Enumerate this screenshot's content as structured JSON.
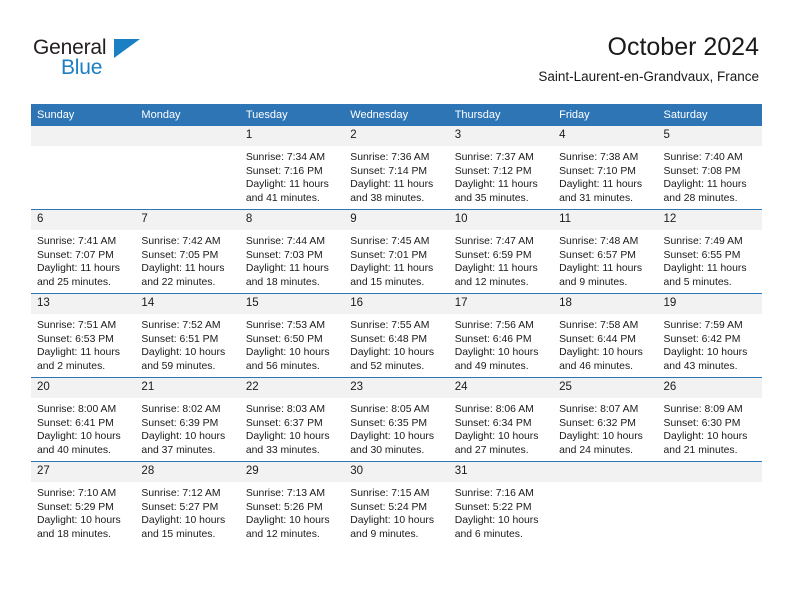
{
  "brand": {
    "name_part1": "General",
    "name_part2": "Blue",
    "accent_color": "#1b7fc4"
  },
  "header": {
    "title": "October 2024",
    "subtitle": "Saint-Laurent-en-Grandvaux, France",
    "header_bg_color": "#2e75b6",
    "daynum_bg_color": "#f2f2f2"
  },
  "weekdays": [
    "Sunday",
    "Monday",
    "Tuesday",
    "Wednesday",
    "Thursday",
    "Friday",
    "Saturday"
  ],
  "labels": {
    "sunrise_prefix": "Sunrise:",
    "sunset_prefix": "Sunset:",
    "daylight_prefix": "Daylight:"
  },
  "weeks": [
    [
      {
        "day": "",
        "empty": true
      },
      {
        "day": "",
        "empty": true
      },
      {
        "day": "1",
        "sunrise": "Sunrise: 7:34 AM",
        "sunset": "Sunset: 7:16 PM",
        "daylight_line1": "Daylight: 11 hours",
        "daylight_line2": "and 41 minutes."
      },
      {
        "day": "2",
        "sunrise": "Sunrise: 7:36 AM",
        "sunset": "Sunset: 7:14 PM",
        "daylight_line1": "Daylight: 11 hours",
        "daylight_line2": "and 38 minutes."
      },
      {
        "day": "3",
        "sunrise": "Sunrise: 7:37 AM",
        "sunset": "Sunset: 7:12 PM",
        "daylight_line1": "Daylight: 11 hours",
        "daylight_line2": "and 35 minutes."
      },
      {
        "day": "4",
        "sunrise": "Sunrise: 7:38 AM",
        "sunset": "Sunset: 7:10 PM",
        "daylight_line1": "Daylight: 11 hours",
        "daylight_line2": "and 31 minutes."
      },
      {
        "day": "5",
        "sunrise": "Sunrise: 7:40 AM",
        "sunset": "Sunset: 7:08 PM",
        "daylight_line1": "Daylight: 11 hours",
        "daylight_line2": "and 28 minutes."
      }
    ],
    [
      {
        "day": "6",
        "sunrise": "Sunrise: 7:41 AM",
        "sunset": "Sunset: 7:07 PM",
        "daylight_line1": "Daylight: 11 hours",
        "daylight_line2": "and 25 minutes."
      },
      {
        "day": "7",
        "sunrise": "Sunrise: 7:42 AM",
        "sunset": "Sunset: 7:05 PM",
        "daylight_line1": "Daylight: 11 hours",
        "daylight_line2": "and 22 minutes."
      },
      {
        "day": "8",
        "sunrise": "Sunrise: 7:44 AM",
        "sunset": "Sunset: 7:03 PM",
        "daylight_line1": "Daylight: 11 hours",
        "daylight_line2": "and 18 minutes."
      },
      {
        "day": "9",
        "sunrise": "Sunrise: 7:45 AM",
        "sunset": "Sunset: 7:01 PM",
        "daylight_line1": "Daylight: 11 hours",
        "daylight_line2": "and 15 minutes."
      },
      {
        "day": "10",
        "sunrise": "Sunrise: 7:47 AM",
        "sunset": "Sunset: 6:59 PM",
        "daylight_line1": "Daylight: 11 hours",
        "daylight_line2": "and 12 minutes."
      },
      {
        "day": "11",
        "sunrise": "Sunrise: 7:48 AM",
        "sunset": "Sunset: 6:57 PM",
        "daylight_line1": "Daylight: 11 hours",
        "daylight_line2": "and 9 minutes."
      },
      {
        "day": "12",
        "sunrise": "Sunrise: 7:49 AM",
        "sunset": "Sunset: 6:55 PM",
        "daylight_line1": "Daylight: 11 hours",
        "daylight_line2": "and 5 minutes."
      }
    ],
    [
      {
        "day": "13",
        "sunrise": "Sunrise: 7:51 AM",
        "sunset": "Sunset: 6:53 PM",
        "daylight_line1": "Daylight: 11 hours",
        "daylight_line2": "and 2 minutes."
      },
      {
        "day": "14",
        "sunrise": "Sunrise: 7:52 AM",
        "sunset": "Sunset: 6:51 PM",
        "daylight_line1": "Daylight: 10 hours",
        "daylight_line2": "and 59 minutes."
      },
      {
        "day": "15",
        "sunrise": "Sunrise: 7:53 AM",
        "sunset": "Sunset: 6:50 PM",
        "daylight_line1": "Daylight: 10 hours",
        "daylight_line2": "and 56 minutes."
      },
      {
        "day": "16",
        "sunrise": "Sunrise: 7:55 AM",
        "sunset": "Sunset: 6:48 PM",
        "daylight_line1": "Daylight: 10 hours",
        "daylight_line2": "and 52 minutes."
      },
      {
        "day": "17",
        "sunrise": "Sunrise: 7:56 AM",
        "sunset": "Sunset: 6:46 PM",
        "daylight_line1": "Daylight: 10 hours",
        "daylight_line2": "and 49 minutes."
      },
      {
        "day": "18",
        "sunrise": "Sunrise: 7:58 AM",
        "sunset": "Sunset: 6:44 PM",
        "daylight_line1": "Daylight: 10 hours",
        "daylight_line2": "and 46 minutes."
      },
      {
        "day": "19",
        "sunrise": "Sunrise: 7:59 AM",
        "sunset": "Sunset: 6:42 PM",
        "daylight_line1": "Daylight: 10 hours",
        "daylight_line2": "and 43 minutes."
      }
    ],
    [
      {
        "day": "20",
        "sunrise": "Sunrise: 8:00 AM",
        "sunset": "Sunset: 6:41 PM",
        "daylight_line1": "Daylight: 10 hours",
        "daylight_line2": "and 40 minutes."
      },
      {
        "day": "21",
        "sunrise": "Sunrise: 8:02 AM",
        "sunset": "Sunset: 6:39 PM",
        "daylight_line1": "Daylight: 10 hours",
        "daylight_line2": "and 37 minutes."
      },
      {
        "day": "22",
        "sunrise": "Sunrise: 8:03 AM",
        "sunset": "Sunset: 6:37 PM",
        "daylight_line1": "Daylight: 10 hours",
        "daylight_line2": "and 33 minutes."
      },
      {
        "day": "23",
        "sunrise": "Sunrise: 8:05 AM",
        "sunset": "Sunset: 6:35 PM",
        "daylight_line1": "Daylight: 10 hours",
        "daylight_line2": "and 30 minutes."
      },
      {
        "day": "24",
        "sunrise": "Sunrise: 8:06 AM",
        "sunset": "Sunset: 6:34 PM",
        "daylight_line1": "Daylight: 10 hours",
        "daylight_line2": "and 27 minutes."
      },
      {
        "day": "25",
        "sunrise": "Sunrise: 8:07 AM",
        "sunset": "Sunset: 6:32 PM",
        "daylight_line1": "Daylight: 10 hours",
        "daylight_line2": "and 24 minutes."
      },
      {
        "day": "26",
        "sunrise": "Sunrise: 8:09 AM",
        "sunset": "Sunset: 6:30 PM",
        "daylight_line1": "Daylight: 10 hours",
        "daylight_line2": "and 21 minutes."
      }
    ],
    [
      {
        "day": "27",
        "sunrise": "Sunrise: 7:10 AM",
        "sunset": "Sunset: 5:29 PM",
        "daylight_line1": "Daylight: 10 hours",
        "daylight_line2": "and 18 minutes."
      },
      {
        "day": "28",
        "sunrise": "Sunrise: 7:12 AM",
        "sunset": "Sunset: 5:27 PM",
        "daylight_line1": "Daylight: 10 hours",
        "daylight_line2": "and 15 minutes."
      },
      {
        "day": "29",
        "sunrise": "Sunrise: 7:13 AM",
        "sunset": "Sunset: 5:26 PM",
        "daylight_line1": "Daylight: 10 hours",
        "daylight_line2": "and 12 minutes."
      },
      {
        "day": "30",
        "sunrise": "Sunrise: 7:15 AM",
        "sunset": "Sunset: 5:24 PM",
        "daylight_line1": "Daylight: 10 hours",
        "daylight_line2": "and 9 minutes."
      },
      {
        "day": "31",
        "sunrise": "Sunrise: 7:16 AM",
        "sunset": "Sunset: 5:22 PM",
        "daylight_line1": "Daylight: 10 hours",
        "daylight_line2": "and 6 minutes."
      },
      {
        "day": "",
        "empty": true
      },
      {
        "day": "",
        "empty": true
      }
    ]
  ]
}
